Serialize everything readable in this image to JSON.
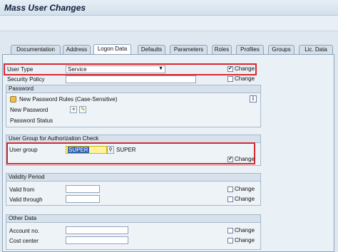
{
  "window": {
    "title": "Mass User Changes"
  },
  "tabs": [
    {
      "label": "Documentation",
      "active": false
    },
    {
      "label": "Address",
      "active": false
    },
    {
      "label": "Logon Data",
      "active": true
    },
    {
      "label": "Defaults",
      "active": false
    },
    {
      "label": "Parameters",
      "active": false
    },
    {
      "label": "Roles",
      "active": false
    },
    {
      "label": "Profiles",
      "active": false
    },
    {
      "label": "Groups",
      "active": false
    },
    {
      "label": "Lic. Data",
      "active": false
    }
  ],
  "logon": {
    "user_type_label": "User Type",
    "user_type_value": "Service",
    "user_type_change_label": "Change",
    "user_type_change_checked": true,
    "security_policy_label": "Security Policy",
    "security_policy_change_label": "Change",
    "security_policy_change_checked": false
  },
  "password": {
    "header": "Password",
    "rules_label": "New Password Rules (Case-Sensitive)",
    "new_password_label": "New Password",
    "password_status_label": "Password Status"
  },
  "user_group": {
    "header": "User Group for Authorization Check",
    "label": "User group",
    "value": "SUPER",
    "description": "SUPER",
    "change_label": "Change",
    "change_checked": true
  },
  "validity": {
    "header": "Validity Period",
    "valid_from_label": "Valid from",
    "valid_through_label": "Valid through",
    "change_label": "Change",
    "valid_from_change_checked": false,
    "valid_through_change_checked": false
  },
  "other": {
    "header": "Other Data",
    "account_no_label": "Account no.",
    "cost_center_label": "Cost center",
    "change_label": "Change",
    "account_no_change_checked": false,
    "cost_center_change_checked": false
  },
  "colors": {
    "highlight_border": "#d9282f",
    "active_field": "#fff3a0"
  },
  "icons": {
    "dropdown": "chevron-down-icon",
    "password_rules": "password-rules-icon",
    "info": "info-icon",
    "search_help": "search-icon",
    "generate_password": "wizard-icon",
    "deactivate_password": "pencil-icon"
  }
}
